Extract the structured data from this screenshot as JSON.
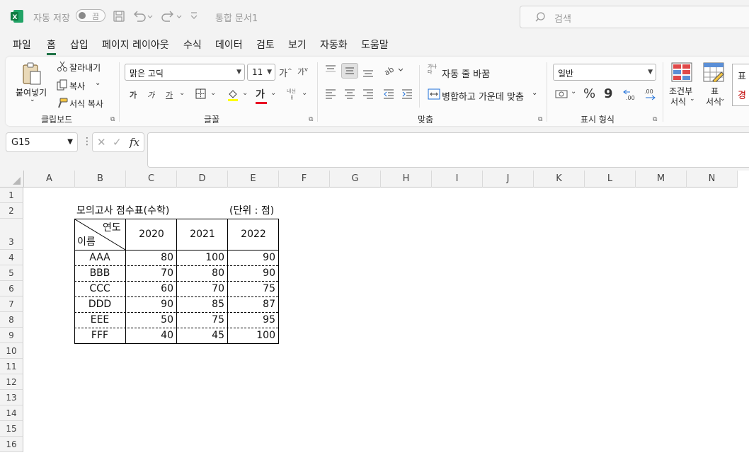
{
  "titlebar": {
    "autosave_label": "자동 저장",
    "autosave_state": "끔",
    "doc_title": "통합 문서1",
    "search_placeholder": "검색"
  },
  "menu": [
    "파일",
    "홈",
    "삽입",
    "페이지 레이아웃",
    "수식",
    "데이터",
    "검토",
    "보기",
    "자동화",
    "도움말"
  ],
  "menu_active": "홈",
  "ribbon": {
    "clipboard": {
      "paste": "붙여넣기",
      "cut": "잘라내기",
      "copy": "복사",
      "format_painter": "서식 복사",
      "group": "클립보드"
    },
    "font": {
      "font_name": "맑은 고딕",
      "font_size": "11",
      "bold": "가",
      "italic": "가",
      "underline": "가",
      "font_color": "가",
      "group": "글꼴"
    },
    "alignment": {
      "wrap_text": "자동 줄 바꿈",
      "merge_center": "병합하고 가운데 맞춤",
      "group": "맞춤",
      "wrap_icon": "가나다"
    },
    "number": {
      "format": "일반",
      "percent": "%",
      "comma": "9",
      "group": "표시 형식"
    },
    "styles": {
      "conditional_1": "조건부",
      "conditional_2": "서식",
      "table_1": "표",
      "table_2": "서식",
      "cell_style_1": "표",
      "cell_style_2": "경"
    }
  },
  "formula_bar": {
    "name_box": "G15",
    "fx": "fx",
    "value": ""
  },
  "columns": [
    "A",
    "B",
    "C",
    "D",
    "E",
    "F",
    "G",
    "H",
    "I",
    "J",
    "K",
    "L",
    "M",
    "N"
  ],
  "rows": [
    "1",
    "2",
    "3",
    "4",
    "5",
    "6",
    "7",
    "8",
    "9",
    "10",
    "11",
    "12",
    "13",
    "14",
    "15",
    "16"
  ],
  "sheet": {
    "title": "모의고사 점수표(수학)",
    "unit": "(단위 : 점)",
    "diag_top": "연도",
    "diag_bottom": "이름",
    "years": [
      "2020",
      "2021",
      "2022"
    ],
    "table": [
      {
        "name": "AAA",
        "scores": [
          "80",
          "100",
          "90"
        ]
      },
      {
        "name": "BBB",
        "scores": [
          "70",
          "80",
          "90"
        ]
      },
      {
        "name": "CCC",
        "scores": [
          "60",
          "70",
          "75"
        ]
      },
      {
        "name": "DDD",
        "scores": [
          "90",
          "85",
          "87"
        ]
      },
      {
        "name": "EEE",
        "scores": [
          "50",
          "75",
          "95"
        ]
      },
      {
        "name": "FFF",
        "scores": [
          "40",
          "45",
          "100"
        ]
      }
    ]
  },
  "colors": {
    "accent": "#1e7145",
    "font_color_bar": "#e81123"
  }
}
